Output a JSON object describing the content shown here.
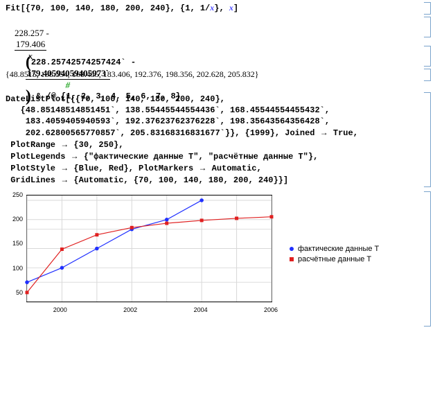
{
  "cell1_in": "Fit[{70, 100, 140, 180, 200, 240}, {1, 1/",
  "cell1_var": "x",
  "cell1_in2": "}, ",
  "cell1_in3": "]",
  "cell2_a": "228.257 -",
  "cell2_num": "179.406",
  "cell2_den": "x",
  "cell3_a": "228.25742574257424` -",
  "cell3_num": "179.40594059405973`",
  "cell3_den": "#",
  "cell3_tail": " & /@ {1, 2, 3, 4, 5, 6, 7, 8}",
  "cell4": "{48.8515, 138.554, 168.455, 183.406, 192.376, 198.356, 202.628, 205.832}",
  "cell5_l1": "DateListPlot[{{70, 100, 140, 180, 200, 240},",
  "cell5_l2": "   {48.85148514851451`, 138.55445544554436`, 168.45544554455432`,",
  "cell5_l3": "    183.4059405940593`, 192.37623762376228`, 198.35643564356428`,",
  "cell5_l4": "    202.62800565770857`, 205.83168316831677`}}, {1999}, Joined",
  "cell5_l4b": "True,",
  "cell5_l5": " PlotRange",
  "cell5_l5b": "{30, 250},",
  "cell5_l6": " PlotLegends",
  "cell5_l6b": "{\"фактические данные Т\", \"расчётные данные Т\"},",
  "cell5_l7": " PlotStyle",
  "cell5_l7b": "{Blue, Red}, PlotMarkers",
  "cell5_l7c": "Automatic,",
  "cell5_l8": " GridLines",
  "cell5_l8b": "{Automatic, {70, 100, 140, 180, 200, 240}}]",
  "legend1": "фактические данные Т",
  "legend2": "расчётные данные Т",
  "chart_data": {
    "type": "line",
    "x_ticks": [
      "2000",
      "2002",
      "2004",
      "2006"
    ],
    "y_ticks": [
      "50",
      "100",
      "150",
      "200",
      "250"
    ],
    "x_years": [
      1999,
      2000,
      2001,
      2002,
      2003,
      2004,
      2005,
      2006
    ],
    "series": [
      {
        "name": "фактические данные Т",
        "color": "#2030ff",
        "marker": "circle",
        "values": [
          70,
          100,
          140,
          180,
          200,
          240
        ]
      },
      {
        "name": "расчётные данные Т",
        "color": "#e02020",
        "marker": "square",
        "values": [
          48.8515,
          138.554,
          168.455,
          183.406,
          192.376,
          198.356,
          202.628,
          205.832
        ]
      }
    ],
    "ylim": [
      30,
      250
    ],
    "xlim": [
      1999,
      2006
    ],
    "grid_y": [
      70,
      100,
      140,
      180,
      200,
      240
    ]
  }
}
